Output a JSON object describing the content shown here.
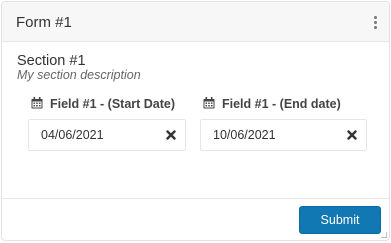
{
  "form": {
    "title": "Form #1",
    "menu_icon": "kebab-menu-icon"
  },
  "section": {
    "title": "Section #1",
    "description": "My section description"
  },
  "fields": [
    {
      "label": "Field #1 - (Start Date)",
      "value": "04/06/2021",
      "icon": "calendar-icon",
      "clear_icon": "clear-icon"
    },
    {
      "label": "Field #1 - (End date)",
      "value": "10/06/2021",
      "icon": "calendar-icon",
      "clear_icon": "clear-icon"
    }
  ],
  "footer": {
    "submit_label": "Submit"
  },
  "colors": {
    "primary_button": "#1178b3",
    "header_background": "#f7f7f7"
  }
}
